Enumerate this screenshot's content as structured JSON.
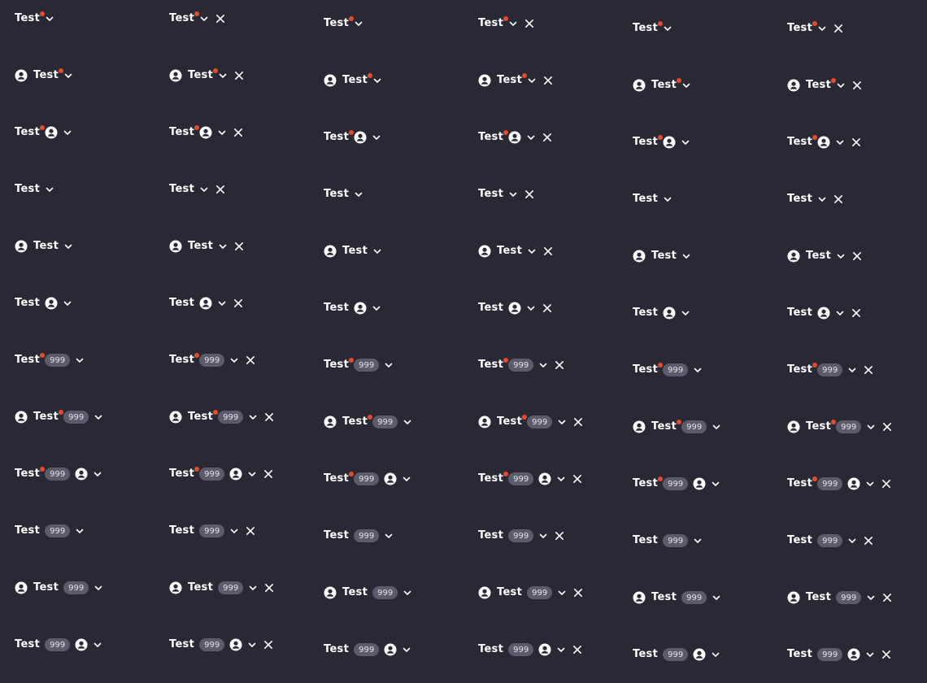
{
  "chip": {
    "label": "Test",
    "count": "999"
  },
  "colors": {
    "background": "#292835",
    "text": "#ffffff",
    "dot": "#e54b2c",
    "badge_bg": "#5b5b6b"
  },
  "icons": {
    "avatar": "user-circle-icon",
    "expand": "chevron-down-icon",
    "remove": "close-icon"
  },
  "columns": [
    {
      "closable": false
    },
    {
      "closable": true
    },
    {
      "closable": false
    },
    {
      "closable": true
    },
    {
      "closable": false
    },
    {
      "closable": true
    }
  ],
  "variants": [
    {
      "avatar": "none",
      "dot": true,
      "badge": false
    },
    {
      "avatar": "leading",
      "dot": true,
      "badge": false
    },
    {
      "avatar": "trailing",
      "dot": true,
      "badge": false
    },
    {
      "avatar": "none",
      "dot": false,
      "badge": false
    },
    {
      "avatar": "leading",
      "dot": false,
      "badge": false
    },
    {
      "avatar": "trailing",
      "dot": false,
      "badge": false
    },
    {
      "avatar": "none",
      "dot": true,
      "badge": true
    },
    {
      "avatar": "leading",
      "dot": true,
      "badge": true
    },
    {
      "avatar": "trailing",
      "dot": true,
      "badge": true
    },
    {
      "avatar": "none",
      "dot": false,
      "badge": true
    },
    {
      "avatar": "leading",
      "dot": false,
      "badge": true
    },
    {
      "avatar": "trailing",
      "dot": false,
      "badge": true
    }
  ]
}
